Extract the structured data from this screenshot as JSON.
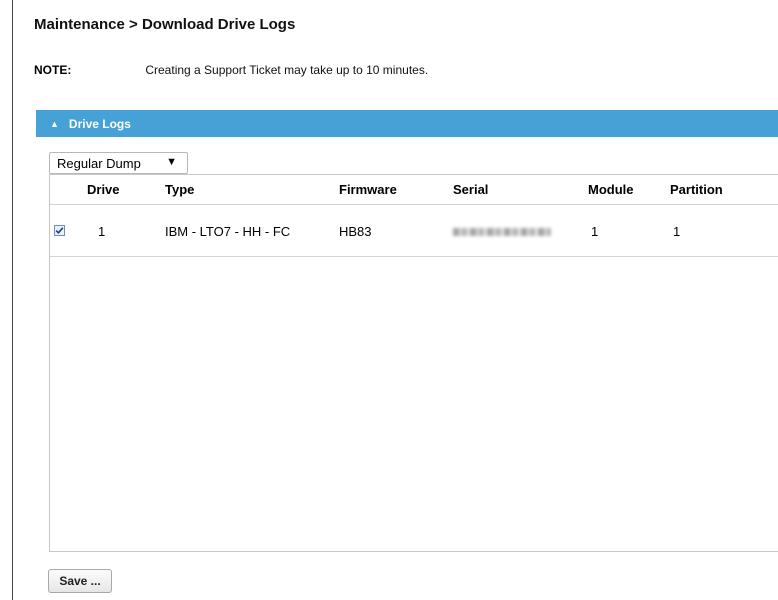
{
  "breadcrumb": "Maintenance > Download Drive Logs",
  "note": {
    "label": "NOTE:",
    "text": "Creating a Support Ticket may take up to 10 minutes."
  },
  "section": {
    "title": "Drive Logs",
    "expanded": true,
    "color": "#46a1d6"
  },
  "dump_select": {
    "value": "Regular Dump"
  },
  "table": {
    "columns": [
      "Drive",
      "Type",
      "Firmware",
      "Serial",
      "Module",
      "Partition"
    ],
    "rows": [
      {
        "checked": true,
        "drive": "1",
        "type": "IBM - LTO7 - HH - FC",
        "firmware": "HB83",
        "serial": "",
        "module": "1",
        "partition": "1"
      }
    ]
  },
  "save_button": "Save ..."
}
